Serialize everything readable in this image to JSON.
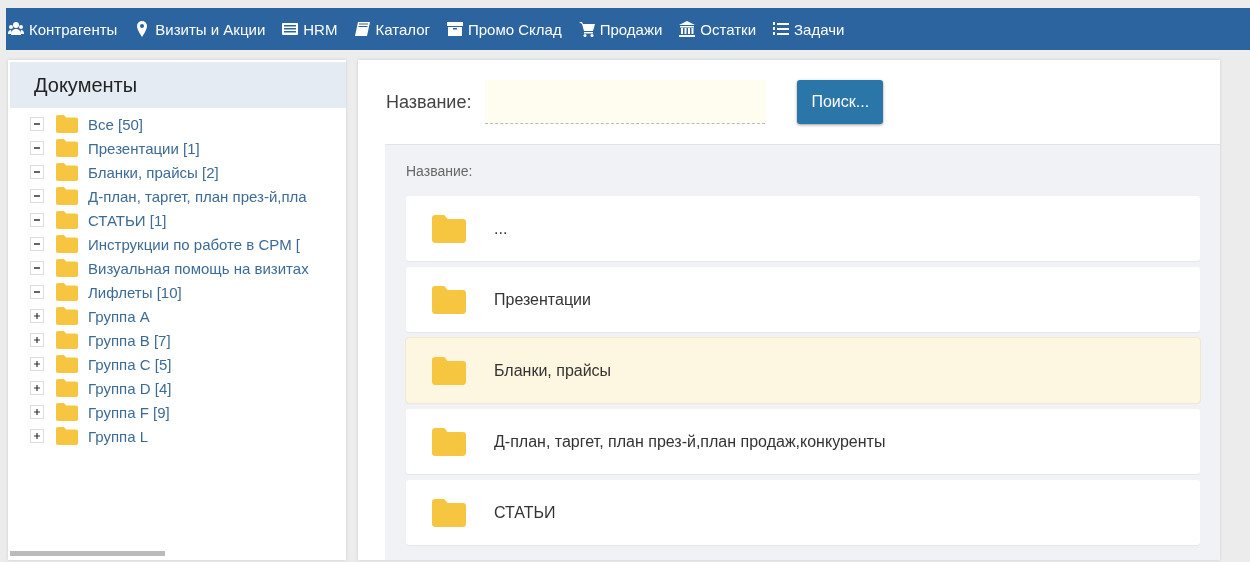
{
  "nav": [
    {
      "label": "Контрагенты"
    },
    {
      "label": "Визиты и Акции"
    },
    {
      "label": "HRM"
    },
    {
      "label": "Каталог"
    },
    {
      "label": "Промо Склад"
    },
    {
      "label": "Продажи"
    },
    {
      "label": "Остатки"
    },
    {
      "label": "Задачи"
    }
  ],
  "sidebar": {
    "title": "Документы",
    "items": [
      {
        "label": "Все [50]",
        "expanded": true
      },
      {
        "label": "Презентации [1]",
        "expanded": true
      },
      {
        "label": "Бланки, прайсы [2]",
        "expanded": true
      },
      {
        "label": "Д-план, таргет, план през-й,пла",
        "expanded": true
      },
      {
        "label": "СТАТЬИ [1]",
        "expanded": true
      },
      {
        "label": "Инструкции по работе в СРМ [",
        "expanded": true
      },
      {
        "label": "Визуальная помощь на визитах",
        "expanded": true
      },
      {
        "label": "Лифлеты [10]",
        "expanded": true
      },
      {
        "label": "Группа А",
        "expanded": false
      },
      {
        "label": "Группа В [7]",
        "expanded": false
      },
      {
        "label": "Группа С [5]",
        "expanded": false
      },
      {
        "label": "Группа D [4]",
        "expanded": false
      },
      {
        "label": "Группа F [9]",
        "expanded": false
      },
      {
        "label": "Группа L",
        "expanded": false
      }
    ]
  },
  "search": {
    "label": "Название:",
    "button": "Поиск..."
  },
  "list": {
    "header": "Название:",
    "rows": [
      {
        "label": "...",
        "selected": false
      },
      {
        "label": "Презентации",
        "selected": false
      },
      {
        "label": "Бланки, прайсы",
        "selected": true
      },
      {
        "label": "Д-план, таргет, план през-й,план продаж,конкуренты",
        "selected": false
      },
      {
        "label": "СТАТЬИ",
        "selected": false
      }
    ]
  }
}
